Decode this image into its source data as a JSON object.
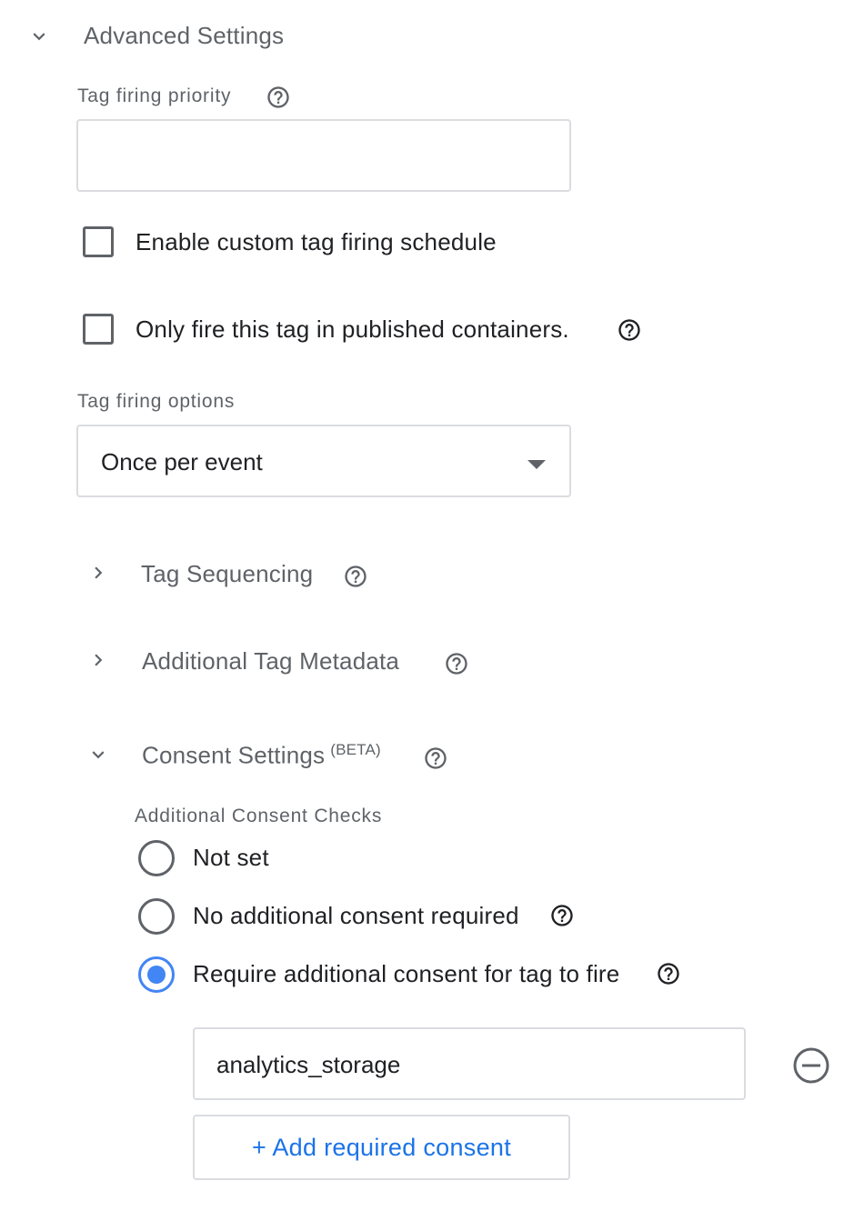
{
  "advanced_settings": {
    "title": "Advanced Settings",
    "expanded": true,
    "expand_icon": "chevron-down-icon"
  },
  "tag_firing_priority": {
    "label": "Tag firing priority",
    "value": "",
    "help_icon": "help-circle-icon"
  },
  "custom_schedule": {
    "label": "Enable custom tag firing schedule",
    "checked": false
  },
  "published_only": {
    "label": "Only fire this tag in published containers.",
    "checked": false,
    "help_icon": "help-circle-icon"
  },
  "tag_firing_options": {
    "label": "Tag firing options",
    "selected": "Once per event",
    "dropdown_icon": "dropdown-arrow-icon"
  },
  "tag_sequencing": {
    "title": "Tag Sequencing",
    "expanded": false,
    "expand_icon": "chevron-right-icon",
    "help_icon": "help-circle-icon"
  },
  "tag_metadata": {
    "title": "Additional Tag Metadata",
    "expanded": false,
    "expand_icon": "chevron-right-icon",
    "help_icon": "help-circle-icon"
  },
  "consent_settings": {
    "title": "Consent Settings",
    "badge": "(BETA)",
    "expanded": true,
    "expand_icon": "chevron-down-icon",
    "help_icon": "help-circle-icon",
    "checks_label": "Additional Consent Checks",
    "options": [
      {
        "label": "Not set",
        "selected": false
      },
      {
        "label": "No additional consent required",
        "selected": false,
        "help_icon": "help-circle-icon"
      },
      {
        "label": "Require additional consent for tag to fire",
        "selected": true,
        "help_icon": "help-circle-icon"
      }
    ],
    "consent_types": [
      {
        "value": "analytics_storage",
        "remove_icon": "remove-circle-icon"
      }
    ],
    "add_button_label": "+ Add required consent"
  },
  "colors": {
    "accent": "#4285f4",
    "link": "#1a73e8",
    "muted_text": "#5f6368",
    "border": "#dadce0"
  }
}
